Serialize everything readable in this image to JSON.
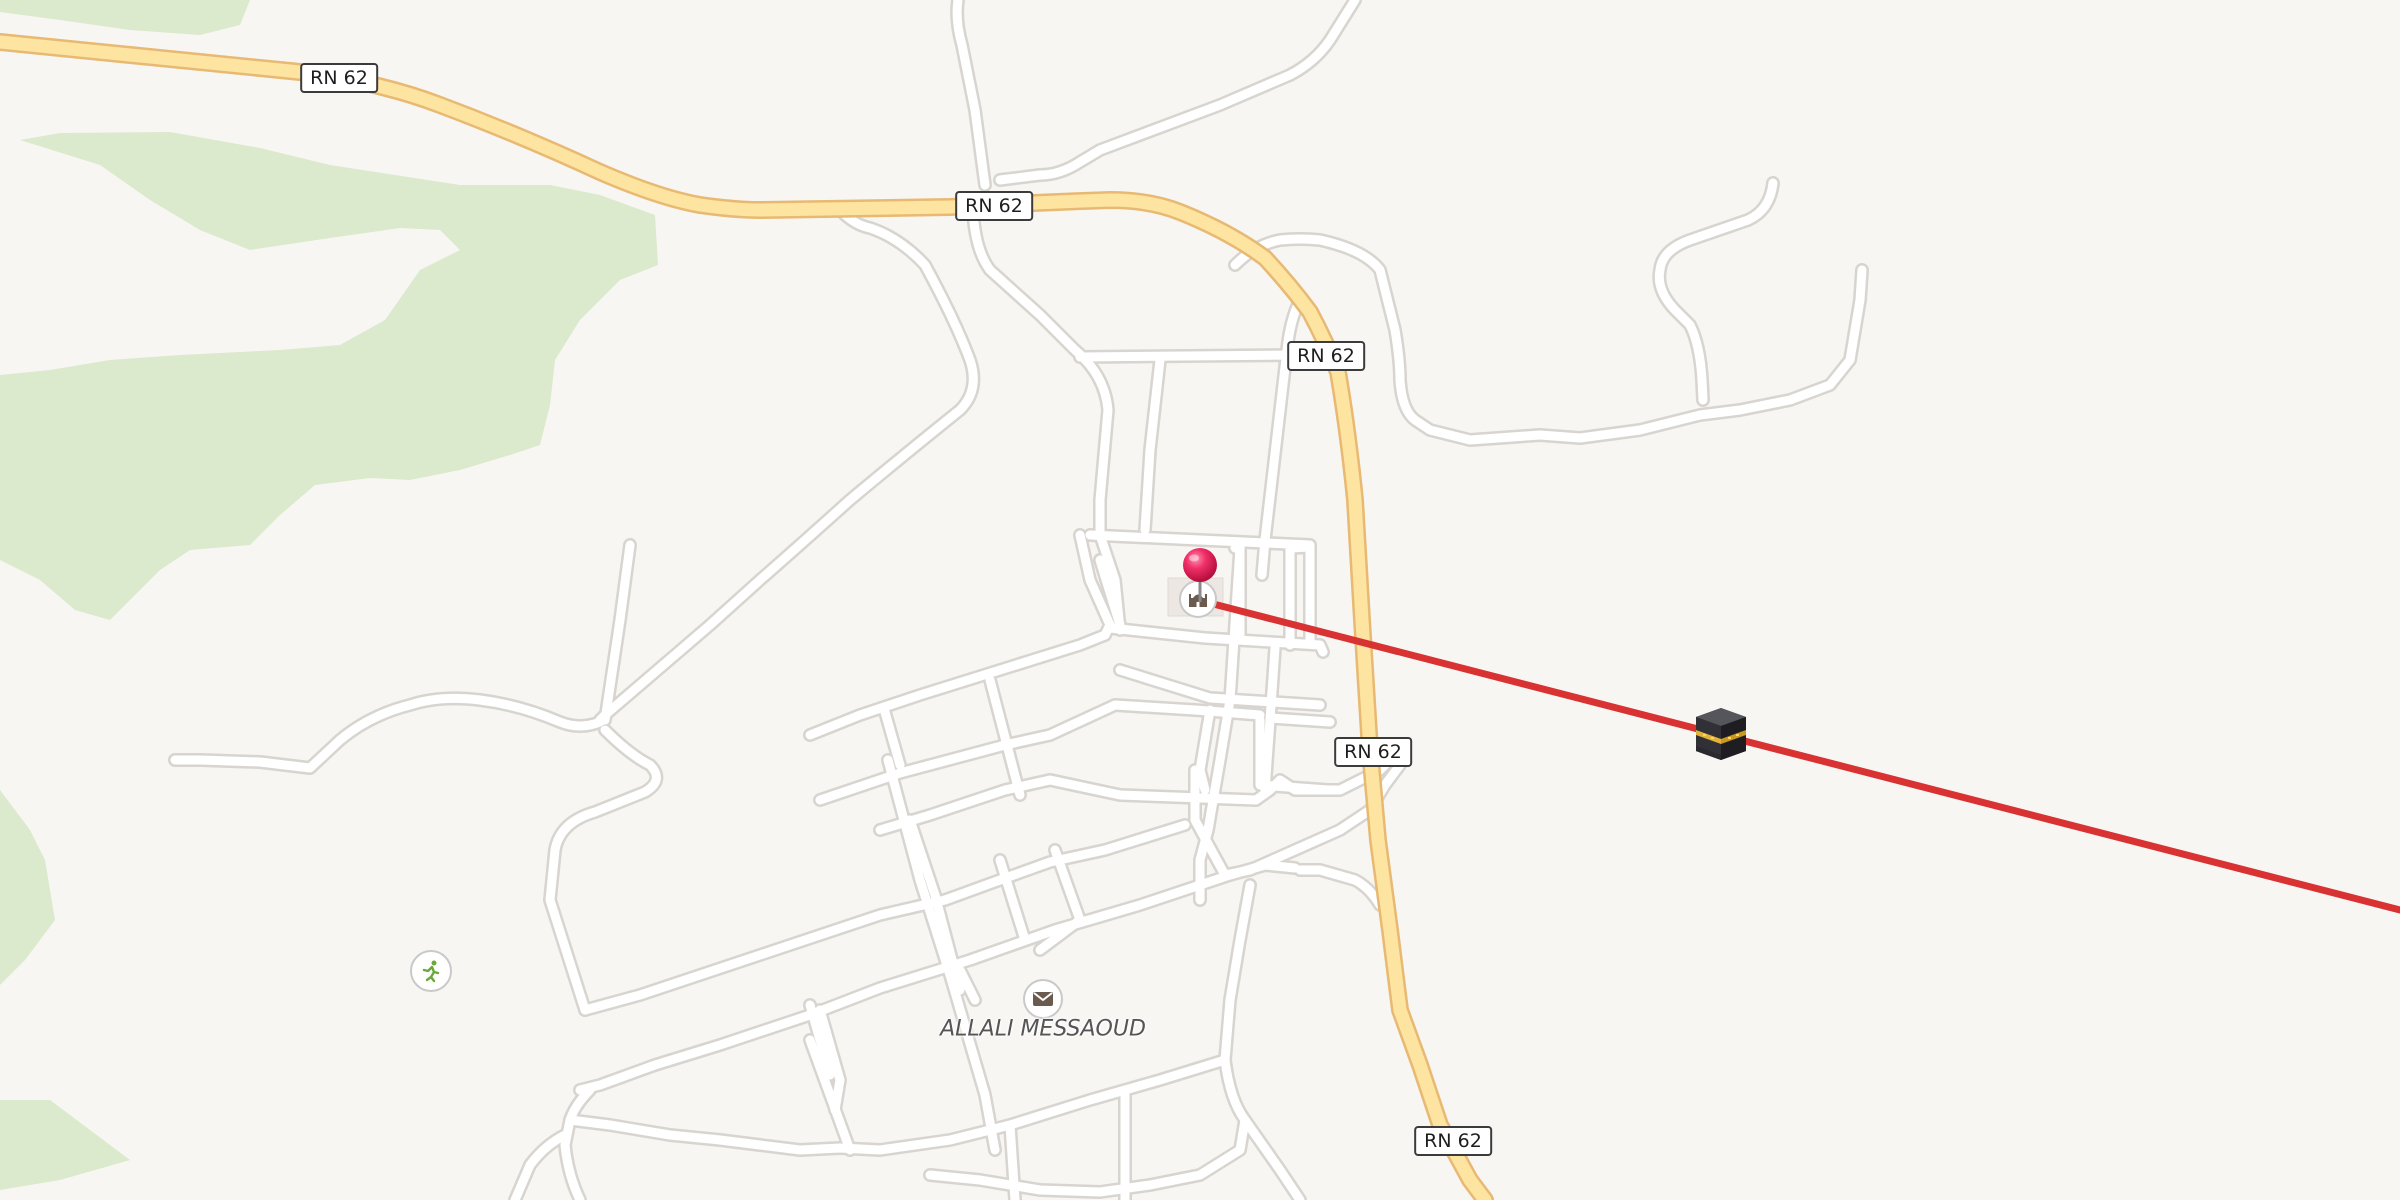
{
  "map": {
    "road_shields": [
      {
        "label": "RN 62"
      },
      {
        "label": "RN 62"
      },
      {
        "label": "RN 62"
      },
      {
        "label": "RN 62"
      },
      {
        "label": "RN 62"
      }
    ],
    "places": [
      {
        "label": "ALLALI MESSAOUD",
        "icon": "mail-icon"
      }
    ],
    "markers": {
      "location_pin": {
        "icon": "location-pin-icon",
        "color": "#e8245e"
      },
      "mosque": {
        "icon": "mosque-icon"
      },
      "sport": {
        "icon": "running-person-icon",
        "color": "#6aa83a"
      },
      "qibla_target": {
        "icon": "kaaba-icon"
      }
    },
    "qibla_line": {
      "color": "#d93232"
    },
    "colors": {
      "land": "#f8f6f3",
      "vegetation": "#dbe9cc",
      "major_road_fill": "#fde4a1",
      "major_road_casing": "#e8b972",
      "minor_road_fill": "#ffffff",
      "minor_road_casing": "#d8d4cf"
    }
  }
}
